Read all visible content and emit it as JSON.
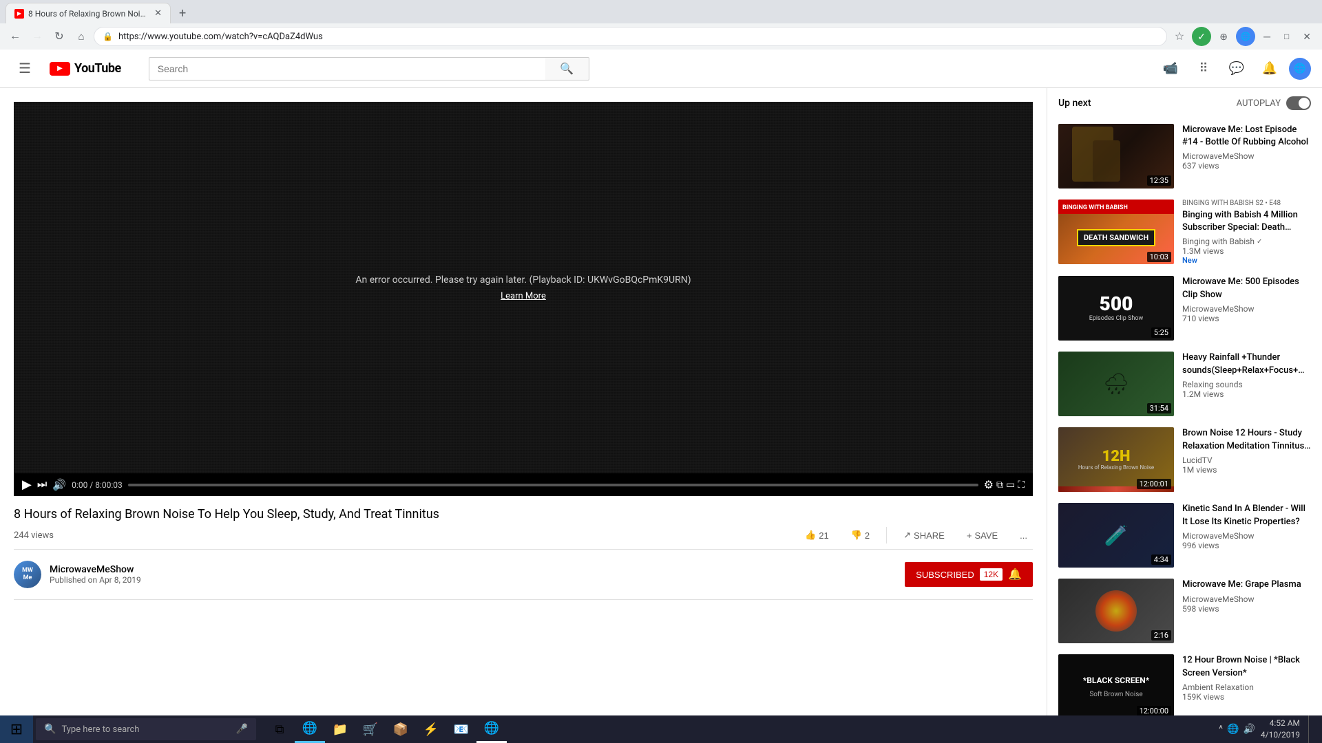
{
  "browser": {
    "tab_title": "8 Hours of Relaxing Brown Nois...",
    "tab_favicon": "YT",
    "url": "https://www.youtube.com/watch?v=cAQDaZ4dWus",
    "new_tab_label": "+"
  },
  "youtube": {
    "logo_text": "YouTube",
    "search_placeholder": "Search",
    "search_icon": "🔍",
    "hamburger_icon": "☰",
    "header_icons": [
      "📹",
      "⠿",
      "💬",
      "🔔"
    ],
    "up_next_label": "Up next",
    "autoplay_label": "AUTOPLAY"
  },
  "video": {
    "title": "8 Hours of Relaxing Brown Noise To Help You Sleep, Study, And Treat Tinnitus",
    "views": "244 views",
    "published": "Published on Apr 8, 2019",
    "channel": "MicrowaveMeShow",
    "error_message": "An error occurred. Please try again later. (Playback ID: UKWvGoBQcPmK9URN)",
    "learn_more": "Learn More",
    "time_current": "0:00",
    "time_total": "8:00:03",
    "likes": "21",
    "dislikes": "2",
    "share_label": "SHARE",
    "save_label": "SAVE",
    "more_label": "...",
    "subscribed_label": "SUBSCRIBED",
    "sub_count": "12K"
  },
  "sidebar": {
    "items": [
      {
        "id": 1,
        "channel_tag": "",
        "title": "Microwave Me: Lost Episode #14 - Bottle Of Rubbing Alcohol",
        "channel": "MicrowaveMeShow",
        "views": "637 views",
        "duration": "12:35",
        "thumb_class": "thumb-1",
        "badge": ""
      },
      {
        "id": 2,
        "channel_tag": "BINGING WITH BABISH S2 • E48",
        "title": "Binging with Babish 4 Million Subscriber Special: Death…",
        "channel": "Binging with Babish",
        "verified": true,
        "views": "1.3M views",
        "duration": "10:03",
        "thumb_class": "thumb-2",
        "badge": "New"
      },
      {
        "id": 3,
        "channel_tag": "",
        "title": "Microwave Me: 500 Episodes Clip Show",
        "channel": "MicrowaveMeShow",
        "views": "710 views",
        "duration": "5:25",
        "thumb_class": "thumb-3",
        "badge": ""
      },
      {
        "id": 4,
        "channel_tag": "",
        "title": "Heavy Rainfall +Thunder sounds(Sleep+Relax+Focus+…",
        "channel": "Relaxing sounds",
        "views": "1.2M views",
        "duration": "31:54",
        "thumb_class": "thumb-4",
        "badge": ""
      },
      {
        "id": 5,
        "channel_tag": "",
        "title": "Brown Noise 12 Hours - Study Relaxation Meditation Tinnitus…",
        "channel": "LucidTV",
        "views": "1M views",
        "duration": "12:00:01",
        "thumb_class": "thumb-5",
        "badge": ""
      },
      {
        "id": 6,
        "channel_tag": "",
        "title": "Kinetic Sand In A Blender - Will It Lose Its Kinetic Properties?",
        "channel": "MicrowaveMeShow",
        "views": "996 views",
        "duration": "4:34",
        "thumb_class": "thumb-6",
        "badge": ""
      },
      {
        "id": 7,
        "channel_tag": "",
        "title": "Microwave Me: Grape Plasma",
        "channel": "MicrowaveMeShow",
        "views": "598 views",
        "duration": "2:16",
        "thumb_class": "thumb-7",
        "badge": ""
      },
      {
        "id": 8,
        "channel_tag": "",
        "title": "12 Hour Brown Noise | *Black Screen Version*",
        "channel": "Ambient Relaxation",
        "views": "159K views",
        "duration": "12:00:00",
        "thumb_class": "thumb-8",
        "badge": ""
      }
    ]
  },
  "taskbar": {
    "search_placeholder": "Type here to search",
    "time": "4:52 AM",
    "date": "4/10/2019",
    "apps": [
      "⊞",
      "🌐",
      "📁",
      "🛒",
      "📦",
      "⚡",
      "📧",
      "🌐"
    ]
  }
}
